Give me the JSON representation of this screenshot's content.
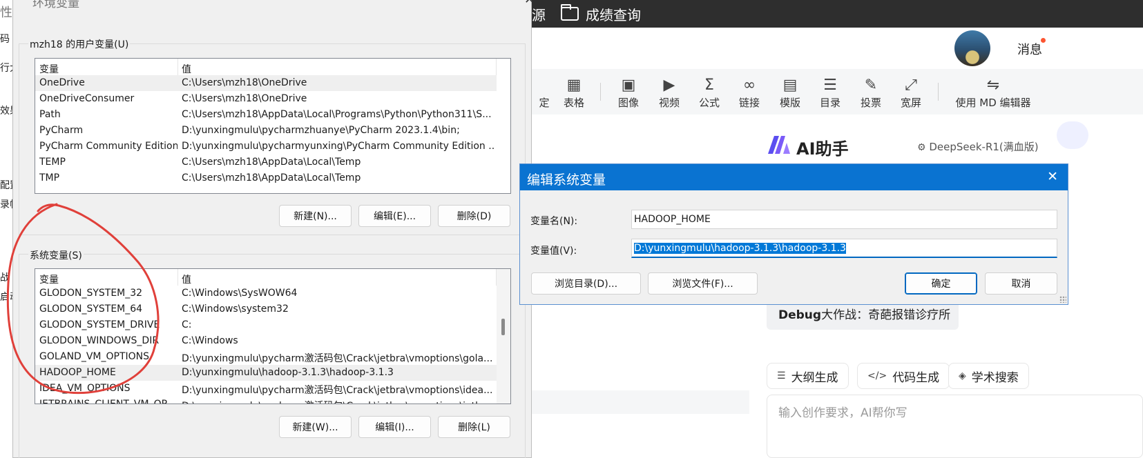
{
  "background_app": {
    "topbar": {
      "nav_partial": "源",
      "nav_grades": "成绩查询"
    },
    "header": {
      "messages": "消息"
    },
    "toolbar": [
      {
        "label": "定",
        "icon": "confirm-icon"
      },
      {
        "label": "表格",
        "icon": "table-icon"
      },
      {
        "label": "图像",
        "icon": "image-icon"
      },
      {
        "label": "视频",
        "icon": "video-icon"
      },
      {
        "label": "公式",
        "icon": "formula-icon"
      },
      {
        "label": "链接",
        "icon": "link-icon"
      },
      {
        "label": "模版",
        "icon": "template-icon"
      },
      {
        "label": "目录",
        "icon": "toc-icon"
      },
      {
        "label": "投票",
        "icon": "vote-icon"
      },
      {
        "label": "宽屏",
        "icon": "widescreen-icon"
      },
      {
        "label": "使用 MD 编辑器",
        "icon": "md-switch-icon"
      }
    ],
    "ai": {
      "title": "AI助手",
      "model": "DeepSeek-R1(满血版)",
      "debug_bold": "Debug",
      "debug_rest": "大作战：奇葩报错诊疗所",
      "chips": [
        {
          "label": "大纲生成",
          "icon": "outline-icon"
        },
        {
          "label": "代码生成",
          "icon": "code-icon"
        },
        {
          "label": "学术搜索",
          "icon": "academic-icon"
        }
      ],
      "prompt_placeholder": "输入创作要求，AI帮你写"
    },
    "left_fragments": [
      "性",
      "码",
      "行大",
      "效果",
      "配置",
      "录帧",
      "战",
      "启动"
    ]
  },
  "env_dialog": {
    "title": "环境变量",
    "user_group": "mzh18 的用户变量(U)",
    "system_group": "系统变量(S)",
    "col_var": "变量",
    "col_val": "值",
    "user_vars": [
      {
        "name": "OneDrive",
        "value": "C:\\Users\\mzh18\\OneDrive"
      },
      {
        "name": "OneDriveConsumer",
        "value": "C:\\Users\\mzh18\\OneDrive"
      },
      {
        "name": "Path",
        "value": "C:\\Users\\mzh18\\AppData\\Local\\Programs\\Python\\Python311\\S..."
      },
      {
        "name": "PyCharm",
        "value": "D:\\yunxingmulu\\pycharmzhuanye\\PyCharm 2023.1.4\\bin;"
      },
      {
        "name": "PyCharm Community Edition",
        "value": "D:\\yunxingmulu\\pycharmyunxing\\PyCharm Community Edition ..."
      },
      {
        "name": "TEMP",
        "value": "C:\\Users\\mzh18\\AppData\\Local\\Temp"
      },
      {
        "name": "TMP",
        "value": "C:\\Users\\mzh18\\AppData\\Local\\Temp"
      }
    ],
    "user_buttons": {
      "new": "新建(N)...",
      "edit": "编辑(E)...",
      "delete": "删除(D)"
    },
    "system_vars": [
      {
        "name": "GLODON_SYSTEM_32",
        "value": "C:\\Windows\\SysWOW64"
      },
      {
        "name": "GLODON_SYSTEM_64",
        "value": "C:\\Windows\\system32"
      },
      {
        "name": "GLODON_SYSTEM_DRIVE",
        "value": "C:"
      },
      {
        "name": "GLODON_WINDOWS_DIR",
        "value": "C:\\Windows"
      },
      {
        "name": "GOLAND_VM_OPTIONS",
        "value": "D:\\yunxingmulu\\pycharm激活码包\\Crack\\jetbra\\vmoptions\\gola..."
      },
      {
        "name": "HADOOP_HOME",
        "value": "D:\\yunxingmulu\\hadoop-3.1.3\\hadoop-3.1.3"
      },
      {
        "name": "IDEA_VM_OPTIONS",
        "value": "D:\\yunxingmulu\\pycharm激活码包\\Crack\\jetbra\\vmoptions\\idea...."
      },
      {
        "name": "JETBRAINS_CLIENT_VM_OP",
        "value": "D:\\yunxingmulu\\pycharm激活码包\\Crack\\jetbra\\vmoptions\\jetb..."
      }
    ],
    "system_selected_index": 5,
    "system_buttons": {
      "new": "新建(W)...",
      "edit": "编辑(I)...",
      "delete": "删除(L)"
    }
  },
  "edit_dialog": {
    "title": "编辑系统变量",
    "name_label": "变量名(N):",
    "value_label": "变量值(V):",
    "name_value": "HADOOP_HOME",
    "value_value": "D:\\yunxingmulu\\hadoop-3.1.3\\hadoop-3.1.3",
    "browse_dir": "浏览目录(D)...",
    "browse_file": "浏览文件(F)...",
    "ok": "确定",
    "cancel": "取消"
  },
  "colors": {
    "title_bar": "#0a73d1",
    "selection": "#0078d7",
    "annotation": "#e0403a",
    "top_nav": "#2e2e2e"
  }
}
